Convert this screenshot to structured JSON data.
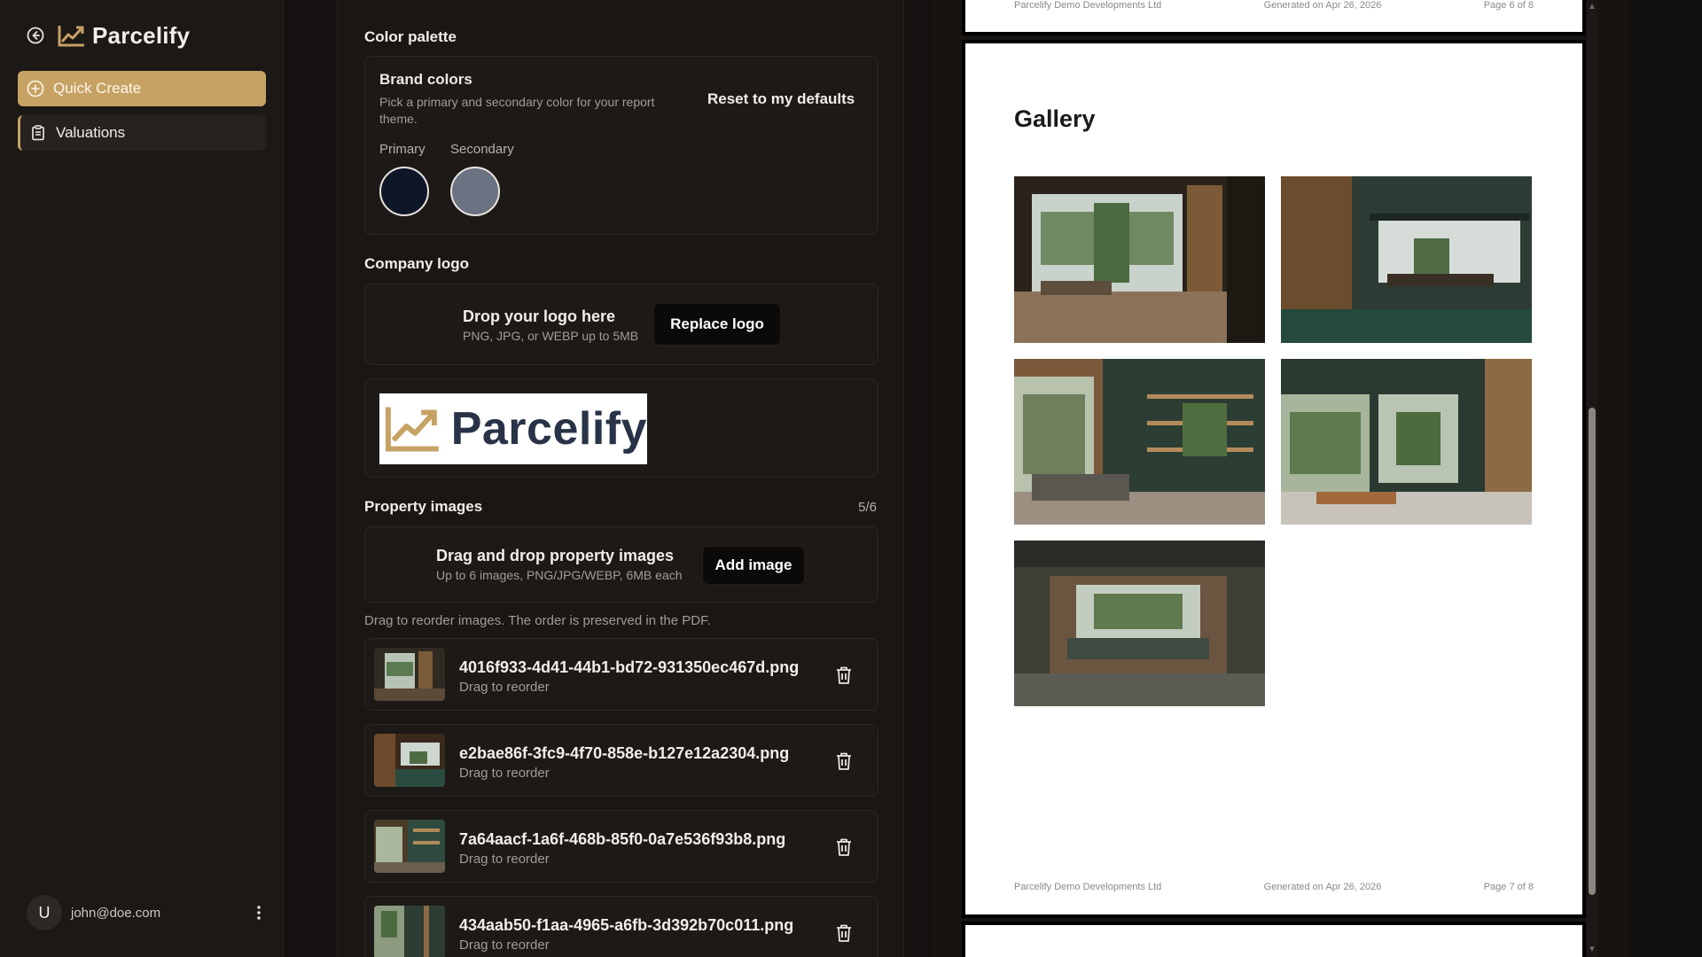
{
  "app": {
    "name": "Parcelify"
  },
  "sidebar": {
    "items": [
      {
        "label": "Quick Create",
        "icon": "plus-circle-icon"
      },
      {
        "label": "Valuations",
        "icon": "clipboard-icon"
      }
    ],
    "user": {
      "initial": "U",
      "email": "john@doe.com"
    }
  },
  "colors": {
    "section_title": "Color palette",
    "card_title": "Brand colors",
    "card_desc": "Pick a primary and secondary color for your report theme.",
    "reset_label": "Reset to my defaults",
    "primary_label": "Primary",
    "secondary_label": "Secondary",
    "primary_hex": "#0e1628",
    "secondary_hex": "#6b7281",
    "accent_hex": "#c6a264"
  },
  "logo": {
    "section_title": "Company logo",
    "drop_title": "Drop your logo here",
    "drop_sub": "PNG, JPG, or WEBP up to 5MB",
    "button_label": "Replace logo",
    "preview_text": "Parcelify"
  },
  "images": {
    "section_title": "Property images",
    "count": "5/6",
    "drop_title": "Drag and drop property images",
    "drop_sub": "Up to 6 images, PNG/JPG/WEBP, 6MB each",
    "button_label": "Add image",
    "hint": "Drag to reorder images. The order is preserved in the PDF.",
    "files": [
      {
        "name": "4016f933-4d41-44b1-bd72-931350ec467d.png",
        "sub": "Drag to reorder"
      },
      {
        "name": "e2bae86f-3fc9-4f70-858e-b127e12a2304.png",
        "sub": "Drag to reorder"
      },
      {
        "name": "7a64aacf-1a6f-468b-85f0-0a7e536f93b8.png",
        "sub": "Drag to reorder"
      },
      {
        "name": "434aab50-f1aa-4965-a6fb-3d392b70c011.png",
        "sub": "Drag to reorder"
      }
    ]
  },
  "preview": {
    "company": "Parcelify Demo Developments Ltd",
    "generated": "Generated on Apr 26, 2026",
    "page6": "Page 6 of 8",
    "page7": "Page 7 of 8",
    "gallery_title": "Gallery"
  }
}
